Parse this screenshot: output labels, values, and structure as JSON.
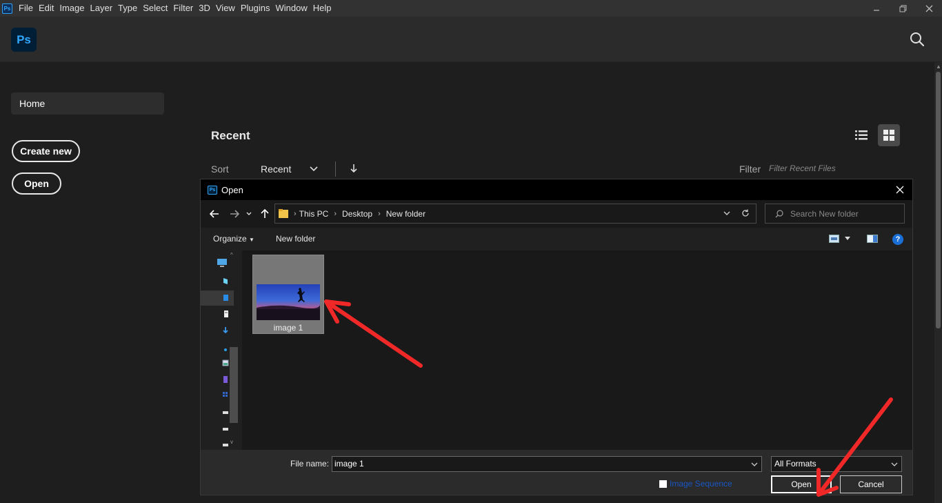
{
  "menubar": {
    "app_icon": "Ps",
    "items": [
      "File",
      "Edit",
      "Image",
      "Layer",
      "Type",
      "Select",
      "Filter",
      "3D",
      "View",
      "Plugins",
      "Window",
      "Help"
    ]
  },
  "header": {
    "logo": "Ps"
  },
  "sidebar": {
    "home": "Home",
    "create_new": "Create new",
    "open": "Open"
  },
  "recent": {
    "title": "Recent",
    "sort_label": "Sort",
    "sort_value": "Recent",
    "filter_label": "Filter",
    "filter_placeholder": "Filter Recent Files"
  },
  "dialog": {
    "title_icon": "Ps",
    "title": "Open",
    "breadcrumb": [
      "This PC",
      "Desktop",
      "New folder"
    ],
    "search_placeholder": "Search New folder",
    "organize": "Organize",
    "new_folder": "New folder",
    "help": "?",
    "files": [
      {
        "name": "image 1"
      }
    ],
    "file_name_label": "File name:",
    "file_name_value": "image 1",
    "format": "All Formats",
    "image_sequence": "Image Sequence",
    "open_button": "Open",
    "cancel_button": "Cancel"
  },
  "colors": {
    "accent_blue": "#31a8ff",
    "arrow_red": "#f02828"
  }
}
